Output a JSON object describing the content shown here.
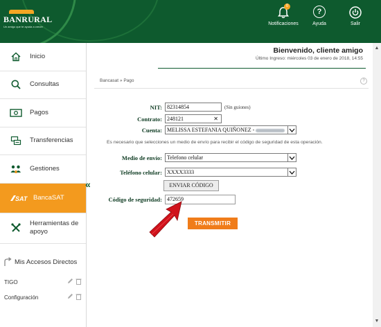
{
  "header": {
    "logo_name": "BANRURAL",
    "logo_tagline": "Un amigo que te ayuda a crecer",
    "actions": [
      {
        "label": "Notificaciones",
        "icon": "bell-icon",
        "badge": "0"
      },
      {
        "label": "Ayuda",
        "icon": "help-icon",
        "glyph": "?"
      },
      {
        "label": "Salir",
        "icon": "power-icon"
      }
    ],
    "brand_color": "#0e5a2e",
    "accent_color": "#f39a1e"
  },
  "sidebar": {
    "items": [
      {
        "label": "Inicio",
        "icon": "home-icon"
      },
      {
        "label": "Consultas",
        "icon": "search-icon"
      },
      {
        "label": "Pagos",
        "icon": "cash-icon"
      },
      {
        "label": "Transferencias",
        "icon": "transfer-icon"
      },
      {
        "label": "Gestiones",
        "icon": "people-icon"
      },
      {
        "label": "BancaSAT",
        "icon": "sat-logo-icon",
        "active": true
      },
      {
        "label": "Herramientas de apoyo",
        "icon": "tools-icon"
      }
    ],
    "sat_logo_text": "SAT"
  },
  "shortcuts": {
    "title": "Mis Accesos Directos",
    "items": [
      {
        "label": "TIGO"
      },
      {
        "label": "Configuración"
      }
    ]
  },
  "main": {
    "welcome": "Bienvenido, cliente amigo",
    "last_login": "Último Ingreso: miércoles 03 de enero de 2018, 14:55",
    "breadcrumb": "Bancasat » Pago",
    "help": "?",
    "form": {
      "nit_label": "NIT:",
      "nit_value": "82314854",
      "nit_note": "(Sin guiones)",
      "contrato_label": "Contrato:",
      "contrato_value": "248121",
      "clear_glyph": "✕",
      "cuenta_label": "Cuenta:",
      "cuenta_value": "MELISSA ESTEFANIA QUIÑONEZ -",
      "info_text": "Es necesario que selecciones un medio de envío para recibir el código de seguridad de esta operación.",
      "medio_label": "Medio de envío:",
      "medio_value": "Telefono celular",
      "telefono_label": "Teléfono celular:",
      "telefono_value": "XXXX3333",
      "enviar_label": "ENVIAR CÓDIGO",
      "codigo_label": "Código de seguridad:",
      "codigo_value": "472659",
      "transmitir_label": "TRANSMITIR"
    }
  }
}
